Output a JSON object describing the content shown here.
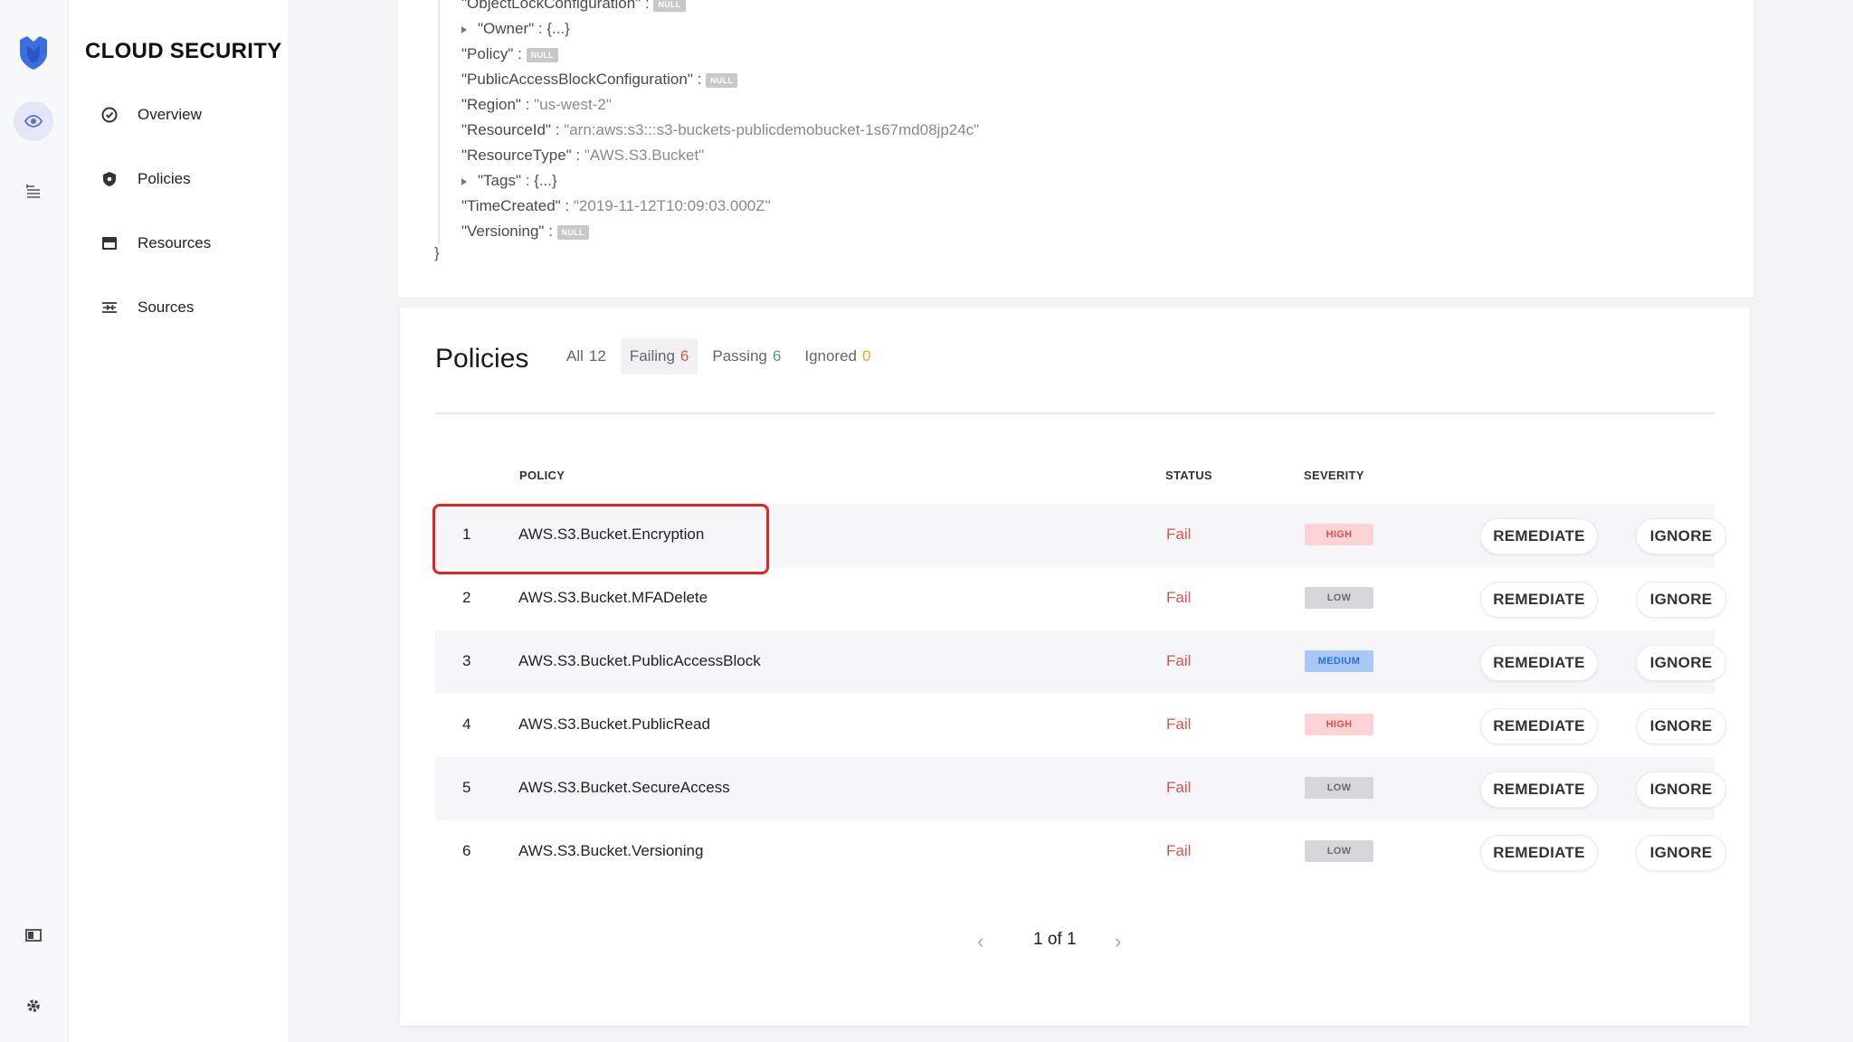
{
  "brand": {
    "title": "CLOUD SECURITY"
  },
  "nav": {
    "items": [
      {
        "label": "Overview",
        "icon": "check-circle-icon"
      },
      {
        "label": "Policies",
        "icon": "shield-icon"
      },
      {
        "label": "Resources",
        "icon": "archive-icon"
      },
      {
        "label": "Sources",
        "icon": "source-icon"
      }
    ]
  },
  "rail": {
    "icons": [
      "shield-logo-icon",
      "eye-icon",
      "list-icon",
      "book-icon",
      "gear-icon"
    ]
  },
  "json": {
    "line_objectlock": {
      "key": "\"ObjectLockConfiguration\"",
      "sep": " : "
    },
    "line_owner": {
      "key": "\"Owner\"",
      "sep": " : ",
      "val": "{...}"
    },
    "line_policy": {
      "key": "\"Policy\"",
      "sep": " : "
    },
    "line_pab": {
      "key": "\"PublicAccessBlockConfiguration\"",
      "sep": " : "
    },
    "line_region": {
      "key": "\"Region\"",
      "sep": " : ",
      "val": "\"us-west-2\""
    },
    "line_resid": {
      "key": "\"ResourceId\"",
      "sep": " : ",
      "val": "\"arn:aws:s3:::s3-buckets-publicdemobucket-1s67md08jp24c\""
    },
    "line_restype": {
      "key": "\"ResourceType\"",
      "sep": " : ",
      "val": "\"AWS.S3.Bucket\""
    },
    "line_tags": {
      "key": "\"Tags\"",
      "sep": " : ",
      "val": "{...}"
    },
    "line_timecreated": {
      "key": "\"TimeCreated\"",
      "sep": " : ",
      "val": "\"2019-11-12T10:09:03.000Z\""
    },
    "line_versioning": {
      "key": "\"Versioning\"",
      "sep": " : "
    },
    "null_label": "NULL",
    "close_brace": "}"
  },
  "policies": {
    "title": "Policies",
    "tabs": [
      {
        "label": "All",
        "count": "12"
      },
      {
        "label": "Failing",
        "count": "6"
      },
      {
        "label": "Passing",
        "count": "6"
      },
      {
        "label": "Ignored",
        "count": "0"
      }
    ],
    "headers": {
      "policy": "POLICY",
      "status": "STATUS",
      "severity": "SEVERITY"
    },
    "rows": [
      {
        "num": "1",
        "name": "AWS.S3.Bucket.Encryption",
        "status": "Fail",
        "severity": "HIGH"
      },
      {
        "num": "2",
        "name": "AWS.S3.Bucket.MFADelete",
        "status": "Fail",
        "severity": "LOW"
      },
      {
        "num": "3",
        "name": "AWS.S3.Bucket.PublicAccessBlock",
        "status": "Fail",
        "severity": "MEDIUM"
      },
      {
        "num": "4",
        "name": "AWS.S3.Bucket.PublicRead",
        "status": "Fail",
        "severity": "HIGH"
      },
      {
        "num": "5",
        "name": "AWS.S3.Bucket.SecureAccess",
        "status": "Fail",
        "severity": "LOW"
      },
      {
        "num": "6",
        "name": "AWS.S3.Bucket.Versioning",
        "status": "Fail",
        "severity": "LOW"
      }
    ],
    "remediate_label": "REMEDIATE",
    "ignore_label": "IGNORE",
    "pagination": {
      "label": "1 of 1"
    }
  },
  "colors": {
    "accent": "#3b6fe0",
    "fail": "#d9534f",
    "pass": "#4ba16c",
    "ignored": "#f0a030",
    "highlight": "#e02424"
  }
}
